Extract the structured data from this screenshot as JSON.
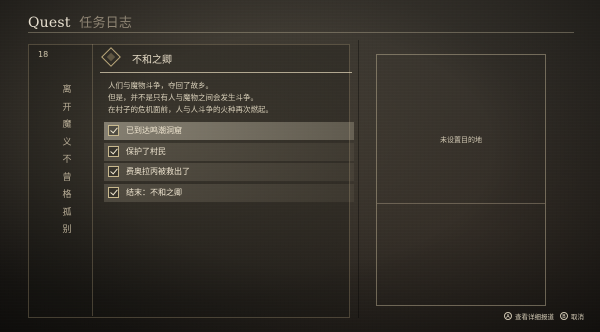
{
  "header": {
    "title": "Quest",
    "subtitle": "任务日志"
  },
  "sidebar": {
    "num_tag": "18",
    "chars": [
      "离",
      "开",
      "魔",
      "义",
      "不",
      "曾",
      "格",
      "孤",
      "别"
    ]
  },
  "quest": {
    "name": "不和之卿",
    "description": [
      "人们与魔物斗争，夺回了故乡。",
      "但是，并不是只有人与魔物之间会发生斗争。",
      "在村子的危机面前，人与人斗争的火种再次燃起。"
    ],
    "objectives": [
      {
        "label": "已到达鸣潮洞窟",
        "state": "active"
      },
      {
        "label": "保护了村民",
        "state": "done"
      },
      {
        "label": "费奥拉丙被救出了",
        "state": "done"
      },
      {
        "label": "结末：不和之卿",
        "state": "done"
      }
    ]
  },
  "map_panel": {
    "caption": "未设置目的地"
  },
  "footer": {
    "buttons": [
      {
        "icon": "circle-a-icon",
        "glyph": "A",
        "label": "查看详细报道"
      },
      {
        "icon": "circle-b-icon",
        "glyph": "B",
        "label": "取消"
      }
    ]
  }
}
